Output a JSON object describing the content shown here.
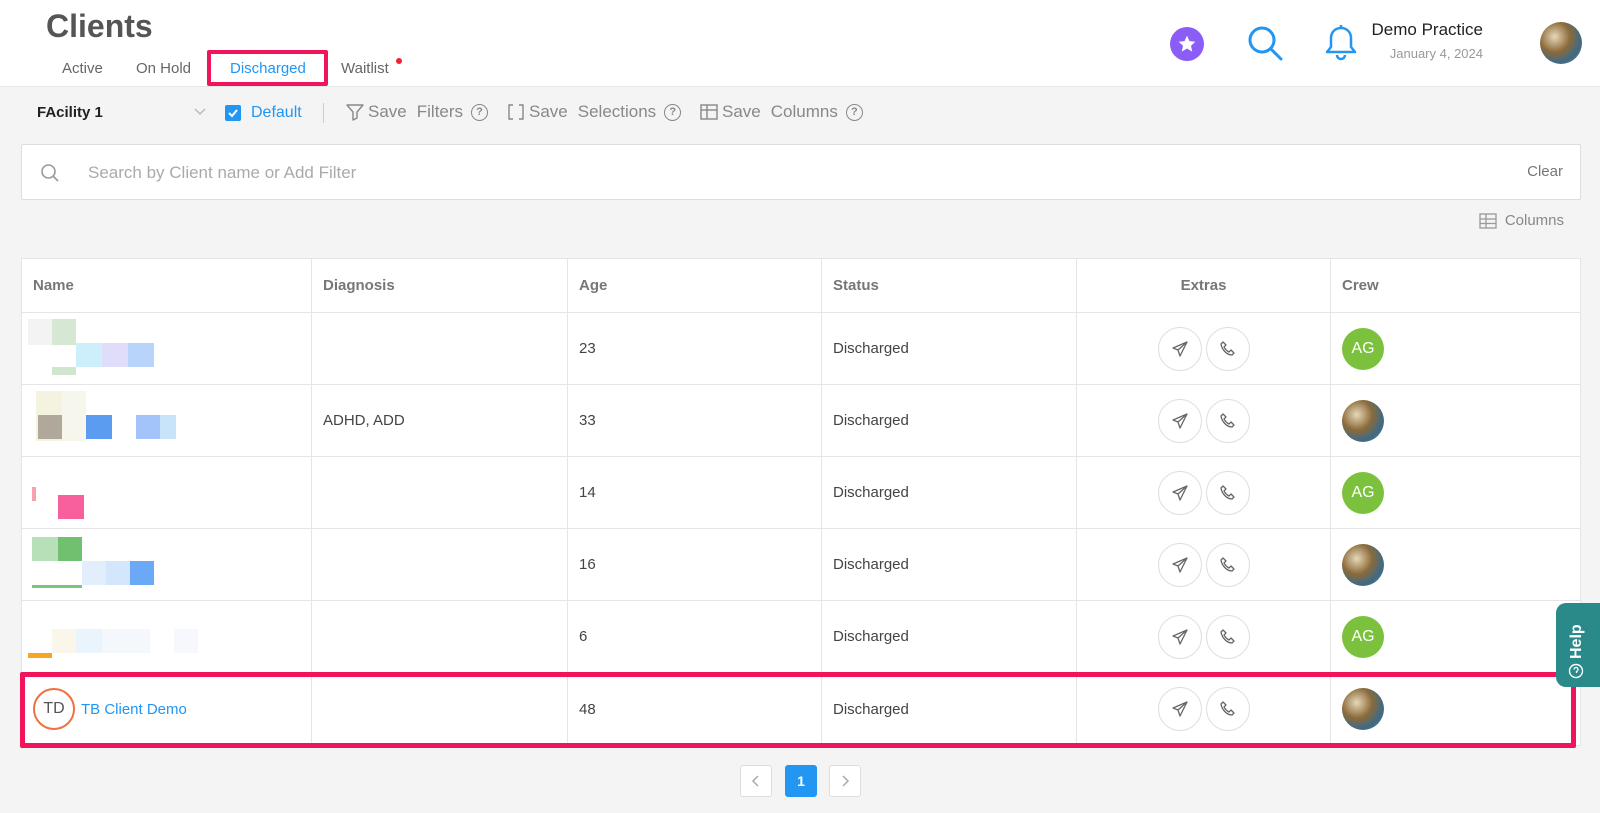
{
  "header": {
    "title": "Clients",
    "tabs": [
      {
        "label": "Active"
      },
      {
        "label": "On Hold"
      },
      {
        "label": "Discharged",
        "active": true
      },
      {
        "label": "Waitlist"
      }
    ],
    "practice_name": "Demo Practice",
    "date": "January 4, 2024",
    "icons": [
      "star-icon",
      "search-icon",
      "bell-icon",
      "user-avatar"
    ]
  },
  "toolbar": {
    "facility": "FAcility 1",
    "default_label": "Default",
    "default_checked": true,
    "save_filters": {
      "save": "Save",
      "label": "Filters"
    },
    "save_selections": {
      "save": "Save",
      "label": "Selections"
    },
    "save_columns": {
      "save": "Save",
      "label": "Columns"
    },
    "help_mark": "?"
  },
  "search": {
    "placeholder": "Search by Client name or Add Filter",
    "value": "",
    "clear_label": "Clear"
  },
  "columns_label": "Columns",
  "table": {
    "headers": [
      "Name",
      "Diagnosis",
      "Age",
      "Status",
      "Extras",
      "Crew"
    ],
    "rows": [
      {
        "name": "",
        "diagnosis": "",
        "age": "23",
        "status": "Discharged",
        "crew": "AG"
      },
      {
        "name": "",
        "diagnosis": "ADHD, ADD",
        "age": "33",
        "status": "Discharged",
        "crew": "photo"
      },
      {
        "name": "",
        "diagnosis": "",
        "age": "14",
        "status": "Discharged",
        "crew": "AG"
      },
      {
        "name": "",
        "diagnosis": "",
        "age": "16",
        "status": "Discharged",
        "crew": "photo"
      },
      {
        "name": "",
        "diagnosis": "",
        "age": "6",
        "status": "Discharged",
        "crew": "AG"
      },
      {
        "name": "TB Client Demo",
        "initials": "TD",
        "diagnosis": "",
        "age": "48",
        "status": "Discharged",
        "crew": "photo"
      }
    ]
  },
  "help_label": "Help",
  "pagination": {
    "current": "1"
  },
  "colors": {
    "accent": "#2196f3",
    "highlight": "#f0145a",
    "crew_green": "#7cc13d",
    "help_teal": "#2a8a8a"
  }
}
